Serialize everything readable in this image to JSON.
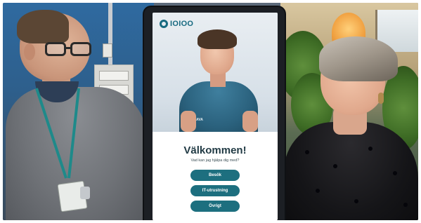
{
  "kiosk": {
    "logo_text": "IOIOO",
    "avatar_shirt_text": "AVA",
    "title": "Välkommen!",
    "subtitle": "Vad kan jag hjälpa dig med?",
    "buttons": [
      {
        "label": "Besök"
      },
      {
        "label": "IT-utrustning"
      },
      {
        "label": "Övrigt"
      }
    ],
    "accent_color": "#1d6f7f"
  }
}
